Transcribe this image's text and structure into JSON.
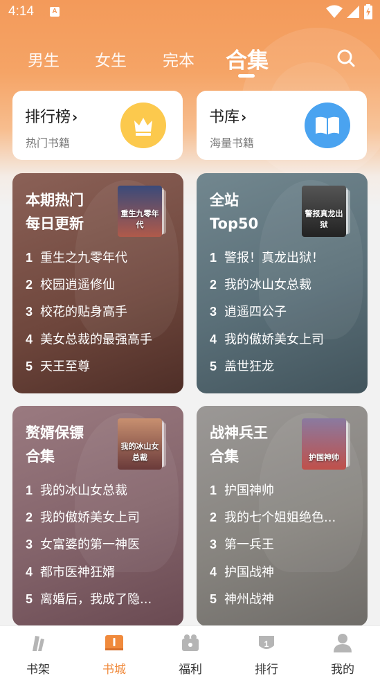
{
  "status_bar": {
    "time": "4:14",
    "notification_icon": "A"
  },
  "tabs": [
    {
      "label": "男生",
      "active": false
    },
    {
      "label": "女生",
      "active": false
    },
    {
      "label": "完本",
      "active": false
    },
    {
      "label": "合集",
      "active": true
    }
  ],
  "quick_links": [
    {
      "title": "排行榜",
      "subtitle": "热门书籍",
      "icon": "crown-icon",
      "color": "#fcc94d"
    },
    {
      "title": "书库",
      "subtitle": "海量书籍",
      "icon": "book-icon",
      "color": "#4aa3f0"
    }
  ],
  "collections": [
    {
      "title_line1": "本期热门",
      "title_line2": "每日更新",
      "cover_text": "重生九零年代",
      "bg": "#7d5147",
      "items": [
        "重生之九零年代",
        "校园逍遥修仙",
        "校花的贴身高手",
        "美女总裁的最强高手",
        "天王至尊"
      ]
    },
    {
      "title_line1": "全站",
      "title_line2": "Top50",
      "cover_text": "警报真龙出狱",
      "bg": "#5f7580",
      "items": [
        "警报！真龙出狱！",
        "我的冰山女总裁",
        "逍遥四公子",
        "我的傲娇美女上司",
        "盖世狂龙"
      ]
    },
    {
      "title_line1": "赘婿保镖",
      "title_line2": "合集",
      "cover_text": "我的冰山女总裁",
      "bg": "#8a6870",
      "items": [
        "我的冰山女总裁",
        "我的傲娇美女上司",
        "女富婆的第一神医",
        "都市医神狂婿",
        "离婚后，我成了隐..."
      ]
    },
    {
      "title_line1": "战神兵王",
      "title_line2": "合集",
      "cover_text": "护国神帅",
      "bg": "#8c8a88",
      "items": [
        "护国神帅",
        "我的七个姐姐绝色...",
        "第一兵王",
        "护国战神",
        "神州战神"
      ]
    }
  ],
  "bottom_nav": [
    {
      "label": "书架",
      "icon": "bookshelf-icon",
      "active": false
    },
    {
      "label": "书城",
      "icon": "bookstore-icon",
      "active": true
    },
    {
      "label": "福利",
      "icon": "gift-icon",
      "active": false
    },
    {
      "label": "排行",
      "icon": "ranking-icon",
      "active": false
    },
    {
      "label": "我的",
      "icon": "profile-icon",
      "active": false
    }
  ],
  "colors": {
    "accent": "#f08a3c",
    "header": "#f39a5a"
  }
}
